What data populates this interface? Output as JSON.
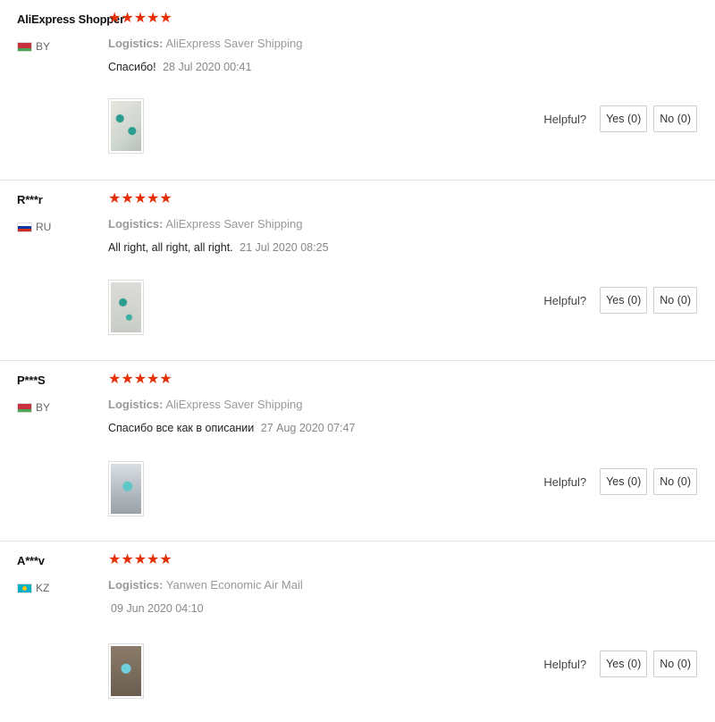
{
  "reviews": [
    {
      "username": "AliExpress Shopper",
      "country": "BY",
      "flag_icon": "belarus-flag-icon",
      "rating": "★★★★★",
      "logistics_label": "Logistics:",
      "logistics_value": "AliExpress Saver Shipping",
      "text": "Спасибо!",
      "date": "28 Jul 2020 00:41",
      "helpful_label": "Helpful?",
      "yes_label": "Yes (0)",
      "no_label": "No (0)"
    },
    {
      "username": "R***r",
      "country": "RU",
      "flag_icon": "russia-flag-icon",
      "rating": "★★★★★",
      "logistics_label": "Logistics:",
      "logistics_value": "AliExpress Saver Shipping",
      "text": "All right, all right, all right.",
      "date": "21 Jul 2020 08:25",
      "helpful_label": "Helpful?",
      "yes_label": "Yes (0)",
      "no_label": "No (0)"
    },
    {
      "username": "P***S",
      "country": "BY",
      "flag_icon": "belarus-flag-icon",
      "rating": "★★★★★",
      "logistics_label": "Logistics:",
      "logistics_value": "AliExpress Saver Shipping",
      "text": "Спасибо все как в описании",
      "date": "27 Aug 2020 07:47",
      "helpful_label": "Helpful?",
      "yes_label": "Yes (0)",
      "no_label": "No (0)"
    },
    {
      "username": "A***v",
      "country": "KZ",
      "flag_icon": "kazakhstan-flag-icon",
      "rating": "★★★★★",
      "logistics_label": "Logistics:",
      "logistics_value": "Yanwen Economic Air Mail",
      "text": "",
      "date": "09 Jun 2020 04:10",
      "helpful_label": "Helpful?",
      "yes_label": "Yes (0)",
      "no_label": "No (0)"
    }
  ],
  "colors": {
    "star": "#e62e04",
    "muted_text": "#999999",
    "divider": "#e5e5e5"
  }
}
